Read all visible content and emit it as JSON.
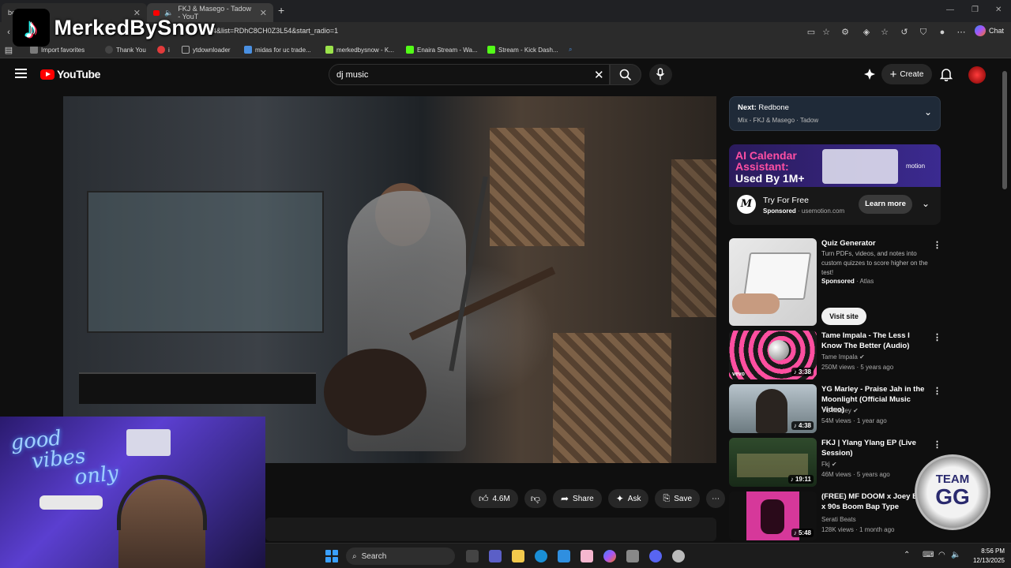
{
  "browser": {
    "tabs": [
      {
        "label": "be - Search"
      },
      {
        "label": "FKJ & Masego - Tadow - YouT"
      }
    ],
    "url": "54&list=RDhC8CH0Z3L54&start_radio=1",
    "chat_label": "Chat",
    "bookmarks": [
      {
        "label": "Import favorites",
        "color": "#7a7a7a"
      },
      {
        "label": "Thank You",
        "color": "#444444"
      },
      {
        "label": "i",
        "color": "#e23b3b"
      },
      {
        "label": "ytdownloader",
        "color": "#7a7a7a"
      },
      {
        "label": "midas for uc trade...",
        "color": "#4a90e2"
      },
      {
        "label": "merkedbysnow - K...",
        "color": "#9be34b"
      },
      {
        "label": "Enaira Stream - Wa...",
        "color": "#53fc18"
      },
      {
        "label": "Stream - Kick Dash...",
        "color": "#53fc18"
      }
    ]
  },
  "overlay": {
    "tiktok_name": "MerkedBySnow",
    "neon_text_1": "good",
    "neon_text_2": "vibes",
    "neon_text_3": "only",
    "badge_line1": "TEAM",
    "badge_line2": "GG"
  },
  "youtube": {
    "logo_text": "YouTube",
    "search_value": "dj music",
    "create_label": "Create",
    "actions": {
      "likes": "4.6M",
      "share": "Share",
      "ask": "Ask",
      "save": "Save"
    },
    "next": {
      "label": "Next:",
      "title": "Redbone",
      "subtitle": "Mix - FKJ & Masego · Tadow"
    },
    "ad_banner": {
      "headline_1": "AI Calendar",
      "headline_2": "Assistant:",
      "headline_3": "Used By 1M+",
      "brand": "motion",
      "cta_title": "Try For Free",
      "sponsored": "Sponsored",
      "domain": "· usemotion.com",
      "learn_more": "Learn more"
    },
    "sidebar": [
      {
        "title": "Quiz Generator",
        "desc": "Turn PDFs, videos, and notes into custom quizzes to score higher on the test!",
        "sponsored": "Sponsored",
        "channel": "· Atlas",
        "cta": "Visit site"
      },
      {
        "title": "Tame Impala - The Less I Know The Better (Audio)",
        "channel": "Tame Impala",
        "meta": "250M views · 5 years ago",
        "duration": "3:38",
        "thumb_tag": "vevo"
      },
      {
        "title": "YG Marley - Praise Jah in the Moonlight (Official Music Video)",
        "channel": "YG Marley",
        "meta": "54M views · 1 year ago",
        "duration": "4:38"
      },
      {
        "title": "FKJ | Ylang Ylang EP (Live Session)",
        "channel": "Fkj",
        "meta": "46M views · 5 years ago",
        "duration": "19:11"
      },
      {
        "title": "(FREE) MF DOOM x Joey Bada$$ x 90s Boom Bap Type",
        "channel": "Serati Beats",
        "meta": "128K views · 1 month ago",
        "duration": "5:48"
      }
    ]
  },
  "taskbar": {
    "search_label": "Search",
    "time": "8:56 PM",
    "date": "12/13/2025"
  }
}
